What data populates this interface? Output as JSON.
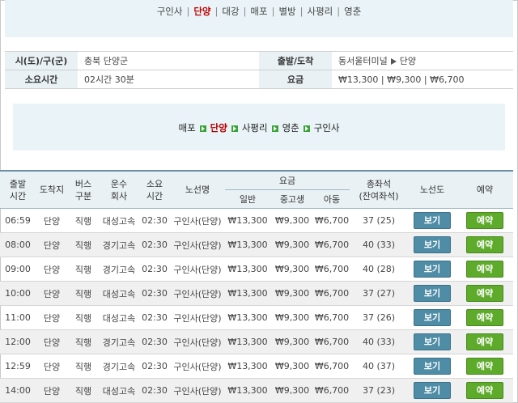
{
  "topnav": {
    "items": [
      "구인사",
      "단양",
      "대강",
      "매포",
      "별방",
      "사평리",
      "영춘"
    ],
    "active_index": 1
  },
  "info": {
    "region_label": "시(도)/구(군)",
    "region_value": "충북 단양군",
    "route_label": "출발/도착",
    "route_from": "동서울터미널",
    "route_to": "단양",
    "duration_label": "소요시간",
    "duration_value": "02시간 30분",
    "fare_label": "요금",
    "fare_value": "₩13,300 | ₩9,300 | ₩6,700"
  },
  "route_path": {
    "stops": [
      "매포",
      "단양",
      "사평리",
      "영춘",
      "구인사"
    ],
    "active_index": 1
  },
  "schedule": {
    "headers": {
      "depart": "출발\n시간",
      "arrive": "도착지",
      "bus_type": "버스\n구분",
      "company": "운수\n회사",
      "duration": "소요\n시간",
      "route": "노선명",
      "fare": "요금",
      "fare_adult": "일반",
      "fare_youth": "중고생",
      "fare_child": "아동",
      "seats": "총좌석\n(잔여좌석)",
      "map": "노선도",
      "book": "예약"
    },
    "view_label": "보기",
    "book_label": "예약",
    "rows": [
      {
        "time": "06:59",
        "dest": "단양",
        "type": "직행",
        "company": "대성고속",
        "dur": "02:30",
        "route": "구인사(단양)",
        "adult": "₩13,300",
        "youth": "₩9,300",
        "child": "₩6,700",
        "seats": "37 (25)"
      },
      {
        "time": "08:00",
        "dest": "단양",
        "type": "직행",
        "company": "경기고속",
        "dur": "02:30",
        "route": "구인사(단양)",
        "adult": "₩13,300",
        "youth": "₩9,300",
        "child": "₩6,700",
        "seats": "40 (33)"
      },
      {
        "time": "09:00",
        "dest": "단양",
        "type": "직행",
        "company": "경기고속",
        "dur": "02:30",
        "route": "구인사(단양)",
        "adult": "₩13,300",
        "youth": "₩9,300",
        "child": "₩6,700",
        "seats": "40 (28)"
      },
      {
        "time": "10:00",
        "dest": "단양",
        "type": "직행",
        "company": "대성고속",
        "dur": "02:30",
        "route": "구인사(단양)",
        "adult": "₩13,300",
        "youth": "₩9,300",
        "child": "₩6,700",
        "seats": "37 (27)"
      },
      {
        "time": "11:00",
        "dest": "단양",
        "type": "직행",
        "company": "대성고속",
        "dur": "02:30",
        "route": "구인사(단양)",
        "adult": "₩13,300",
        "youth": "₩9,300",
        "child": "₩6,700",
        "seats": "37 (26)"
      },
      {
        "time": "12:00",
        "dest": "단양",
        "type": "직행",
        "company": "경기고속",
        "dur": "02:30",
        "route": "구인사(단양)",
        "adult": "₩13,300",
        "youth": "₩9,300",
        "child": "₩6,700",
        "seats": "40 (33)"
      },
      {
        "time": "12:59",
        "dest": "단양",
        "type": "직행",
        "company": "경기고속",
        "dur": "02:30",
        "route": "구인사(단양)",
        "adult": "₩13,300",
        "youth": "₩9,300",
        "child": "₩6,700",
        "seats": "40 (37)"
      },
      {
        "time": "14:00",
        "dest": "단양",
        "type": "직행",
        "company": "대성고속",
        "dur": "02:30",
        "route": "구인사(단양)",
        "adult": "₩13,300",
        "youth": "₩9,300",
        "child": "₩6,700",
        "seats": "37 (23)"
      }
    ]
  }
}
